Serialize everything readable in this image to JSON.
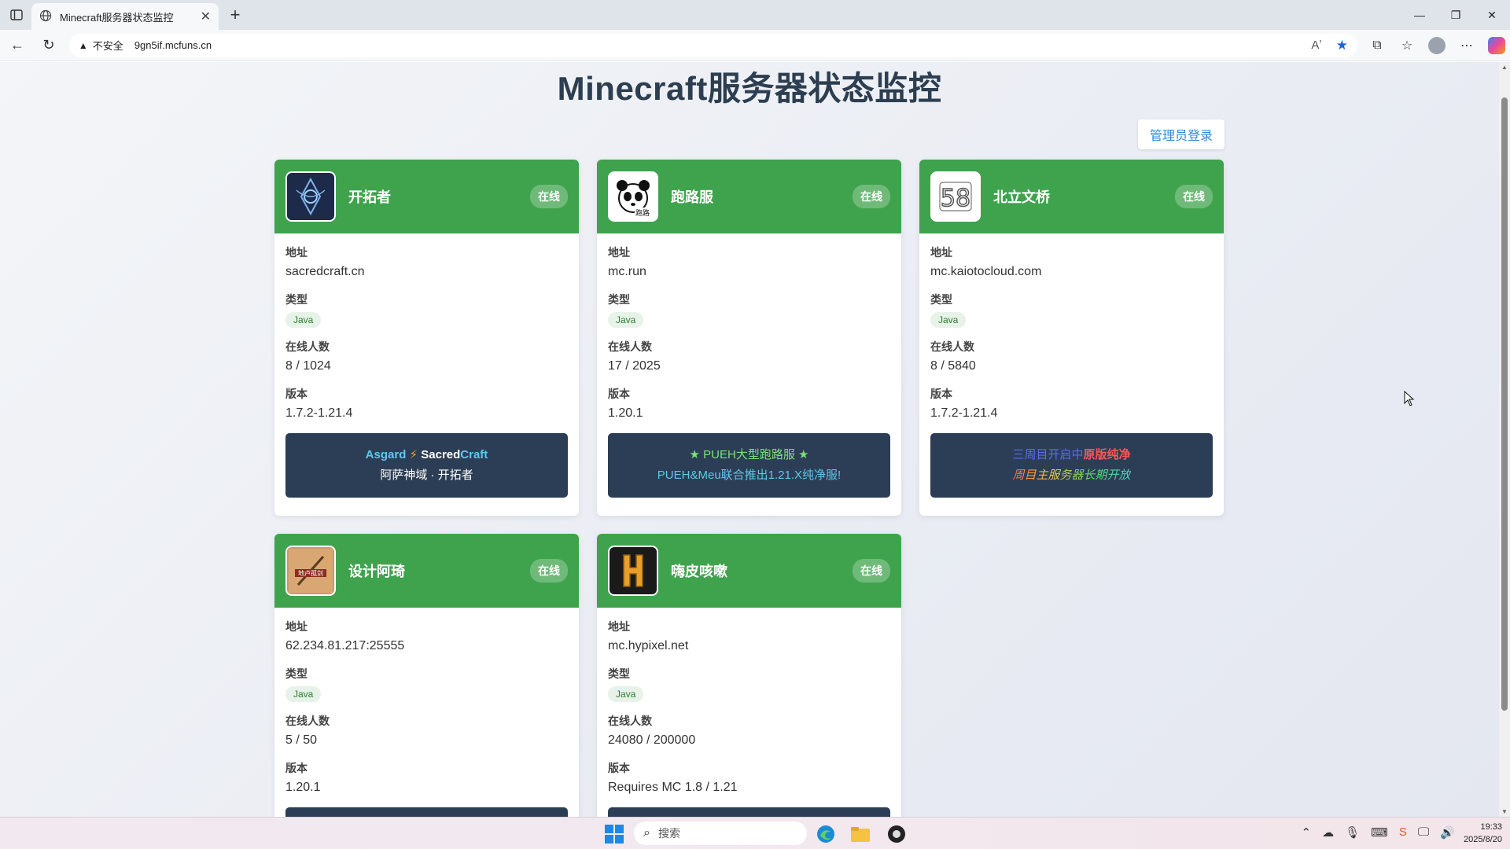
{
  "browser": {
    "tab_title": "Minecraft服务器状态监控",
    "insecure_label": "不安全",
    "url": "9gn5if.mcfuns.cn"
  },
  "page": {
    "title": "Minecraft服务器状态监控",
    "admin_login": "管理员登录",
    "labels": {
      "address": "地址",
      "type": "类型",
      "players": "在线人数",
      "version": "版本"
    }
  },
  "servers": [
    {
      "name": "开拓者",
      "status": "在线",
      "address": "sacredcraft.cn",
      "type": "Java",
      "players": "8 / 1024",
      "version": "1.7.2-1.21.4",
      "motd_line1_a": "Asgard",
      "motd_line1_sep": "⚡",
      "motd_line1_b": "Sacred",
      "motd_line1_c": "Craft",
      "motd_line2": "阿萨神域 · 开拓者"
    },
    {
      "name": "跑路服",
      "status": "在线",
      "address": "mc.run",
      "type": "Java",
      "players": "17 / 2025",
      "version": "1.20.1",
      "motd_line1": "★ PUEH大型跑路服 ★",
      "motd_line2": "PUEH&Meu联合推出1.21.X纯净服!"
    },
    {
      "name": "北立文桥",
      "status": "在线",
      "address": "mc.kaiotocloud.com",
      "type": "Java",
      "players": "8 / 5840",
      "version": "1.7.2-1.21.4",
      "motd_line1_a": "三周目开启中",
      "motd_line1_b": "原版纯净",
      "motd_line2": "周目主服务器长期开放"
    },
    {
      "name": "设计阿琦",
      "status": "在线",
      "address": "62.234.81.217:25555",
      "type": "Java",
      "players": "5 / 50",
      "version": "1.20.1"
    },
    {
      "name": "嗨皮咳嗽",
      "status": "在线",
      "address": "mc.hypixel.net",
      "type": "Java",
      "players": "24080 / 200000",
      "version": "Requires MC 1.8 / 1.21"
    }
  ],
  "taskbar": {
    "search_placeholder": "搜索",
    "time": "19:33",
    "date": "2025/8/20"
  },
  "colors": {
    "card_header_green": "#3fa34d",
    "motd_bg": "#2c3e55",
    "title_color": "#2c3e50",
    "admin_link": "#2f89d6"
  }
}
